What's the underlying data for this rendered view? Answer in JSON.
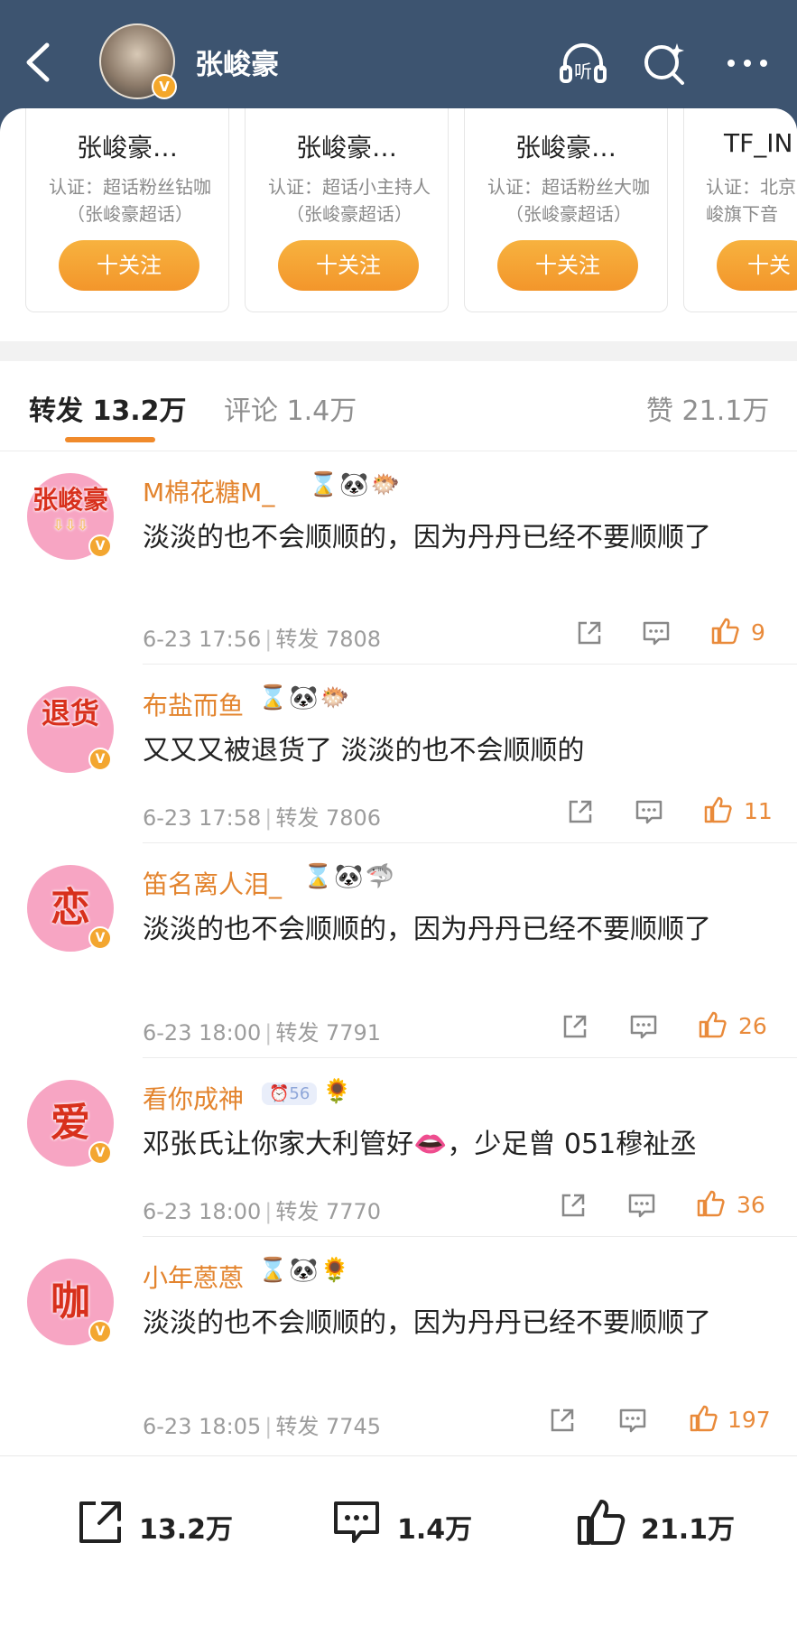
{
  "header": {
    "title": "张峻豪",
    "avatar_badge": "V"
  },
  "recommendations": [
    {
      "name": "张峻豪…",
      "desc": "认证：超话粉丝钻咖（张峻豪超话）",
      "follow": "十关注"
    },
    {
      "name": "张峻豪…",
      "desc": "认证：超话小主持人（张峻豪超话）",
      "follow": "十关注"
    },
    {
      "name": "张峻豪…",
      "desc": "认证：超话粉丝大咖（张峻豪超话）",
      "follow": "十关注"
    },
    {
      "name": "TF_IN",
      "desc": "认证：北京峻旗下音",
      "follow": "十关"
    }
  ],
  "tabs": {
    "repost": "转发 13.2万",
    "comment": "评论 1.4万",
    "like": "赞 21.1万"
  },
  "accent": "#f08a2b",
  "items": [
    {
      "avatar": "张峻豪",
      "avatar_sub": "⇩⇩⇩",
      "name": "M棉花糖M_",
      "badges": [
        "⌛",
        "🐼",
        "🐡"
      ],
      "text": "淡淡的也不会顺顺的，因为丹丹已经不要顺顺了",
      "time": "6-23 17:56",
      "repost": "转发 7808",
      "likes": "9"
    },
    {
      "avatar": "退货",
      "name": "布盐而鱼",
      "badges": [
        "⌛",
        "🐼",
        "🐡"
      ],
      "text": "又又又被退货了 淡淡的也不会顺顺的",
      "time": "6-23 17:58",
      "repost": "转发 7806",
      "likes": "11"
    },
    {
      "avatar": "恋",
      "name": "笛名离人泪_",
      "badges": [
        "⌛",
        "🐼",
        "🦈"
      ],
      "text": "淡淡的也不会顺顺的，因为丹丹已经不要顺顺了",
      "time": "6-23 18:00",
      "repost": "转发 7791",
      "likes": "26"
    },
    {
      "avatar": "爱",
      "name": "看你成神",
      "badges": [
        "⏰56",
        "🌻"
      ],
      "text": "邓张氏让你家大利管好👄，少足曾 051穆祉丞",
      "time": "6-23 18:00",
      "repost": "转发 7770",
      "likes": "36"
    },
    {
      "avatar": "咖",
      "name": "小年蒽蒽",
      "badges": [
        "⌛",
        "🐼",
        "🌻"
      ],
      "text": "淡淡的也不会顺顺的，因为丹丹已经不要顺顺了",
      "time": "6-23 18:05",
      "repost": "转发 7745",
      "likes": "197"
    }
  ],
  "bottom": {
    "repost": "13.2万",
    "comment": "1.4万",
    "like": "21.1万"
  },
  "icons": {
    "back": "chevron-left-icon",
    "listen": "headphones-icon",
    "search": "search-sparkle-icon",
    "more": "more-dots-icon",
    "share": "share-icon",
    "comment": "comment-bubble-icon",
    "like": "thumbs-up-icon"
  }
}
